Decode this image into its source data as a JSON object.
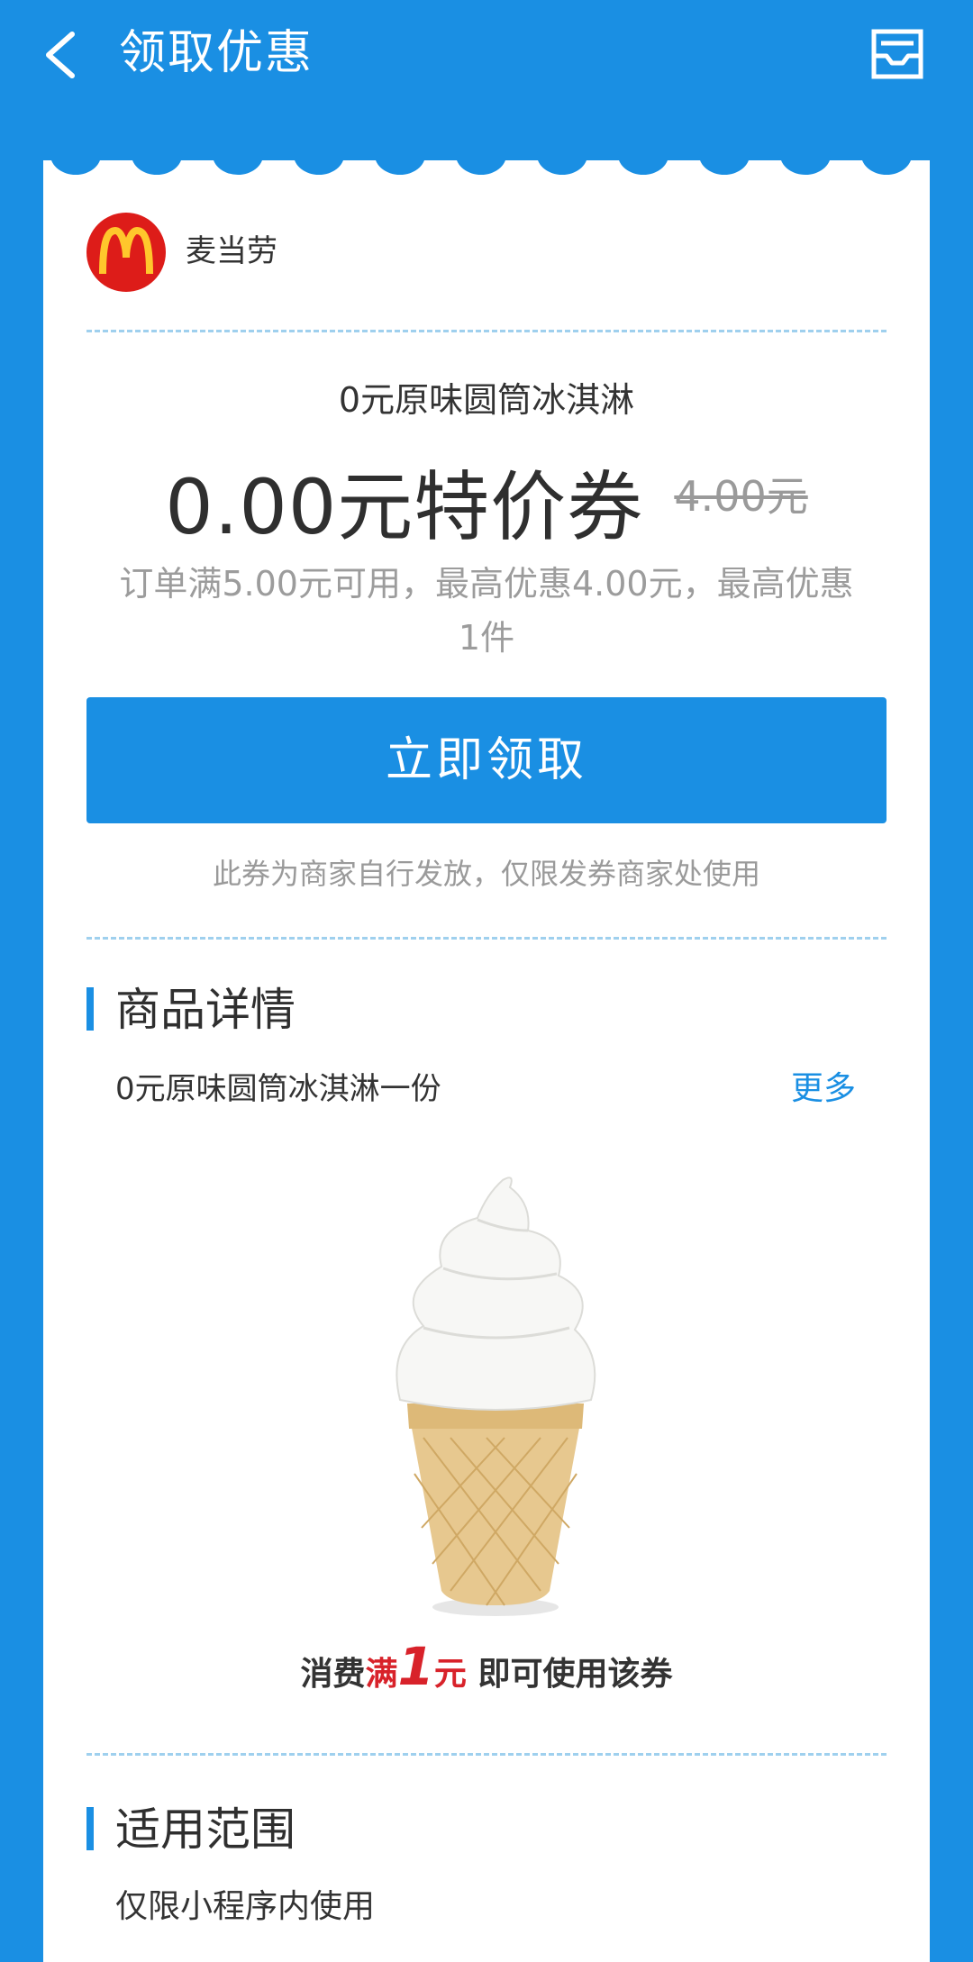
{
  "header": {
    "title": "领取优惠",
    "back_icon": "chevron-left-icon",
    "inbox_icon": "inbox-icon"
  },
  "merchant": {
    "name": "麦当劳",
    "logo_icon": "mcdonalds-logo"
  },
  "coupon": {
    "subtitle": "0元原味圆筒冰淇淋",
    "price_label": "0.00元特价券",
    "original_price": "4.00元",
    "conditions": "订单满5.00元可用，最高优惠4.00元，最高优惠1件",
    "claim_button": "立即领取",
    "note": "此券为商家自行发放，仅限发券商家处使用"
  },
  "details": {
    "section_title": "商品详情",
    "item_text": "0元原味圆筒冰淇淋一份",
    "more_link": "更多",
    "product_image": "ice-cream-cone-image",
    "promo": {
      "part1": "消费",
      "part2": "满",
      "part3": "1",
      "part4": "元",
      "part5": " 即可使用该券"
    }
  },
  "scope": {
    "section_title": "适用范围",
    "text": "仅限小程序内使用"
  },
  "colors": {
    "brand_blue": "#1a8fe3",
    "mcd_red": "#dd1c19",
    "mcd_yellow": "#ffc72c"
  }
}
